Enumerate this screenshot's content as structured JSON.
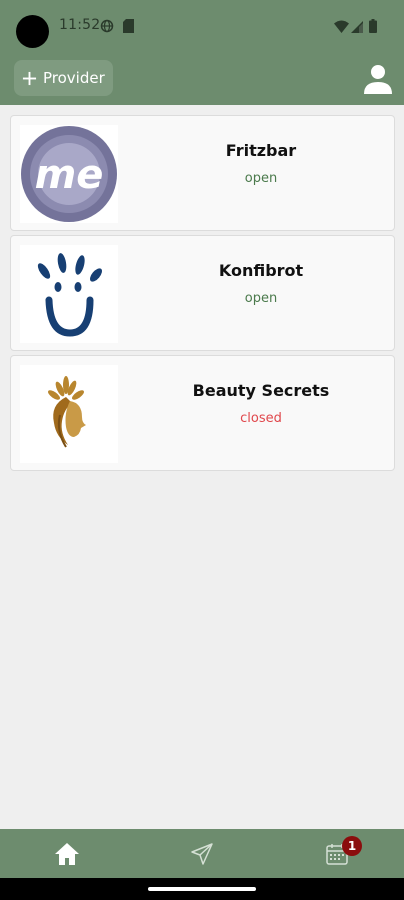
{
  "status_bar": {
    "time": "11:52"
  },
  "toolbar": {
    "add_provider_label": "Provider",
    "add_icon": "plus-icon",
    "profile_icon": "person-icon"
  },
  "providers": [
    {
      "name": "Fritzbar",
      "status": "open",
      "logo": "me-circle-logo"
    },
    {
      "name": "Konfibrot",
      "status": "open",
      "logo": "smiley-hand-logo"
    },
    {
      "name": "Beauty Secrets",
      "status": "closed",
      "logo": "woman-profile-logo"
    }
  ],
  "bottom_nav": {
    "items": [
      {
        "icon": "home-icon",
        "active": true
      },
      {
        "icon": "send-icon",
        "active": false
      },
      {
        "icon": "calendar-icon",
        "active": false
      }
    ],
    "calendar_badge": "1"
  },
  "colors": {
    "header": "#6d8c6e",
    "open": "#4b7a4c",
    "closed": "#e0474c",
    "badge": "#8b0d0d"
  }
}
